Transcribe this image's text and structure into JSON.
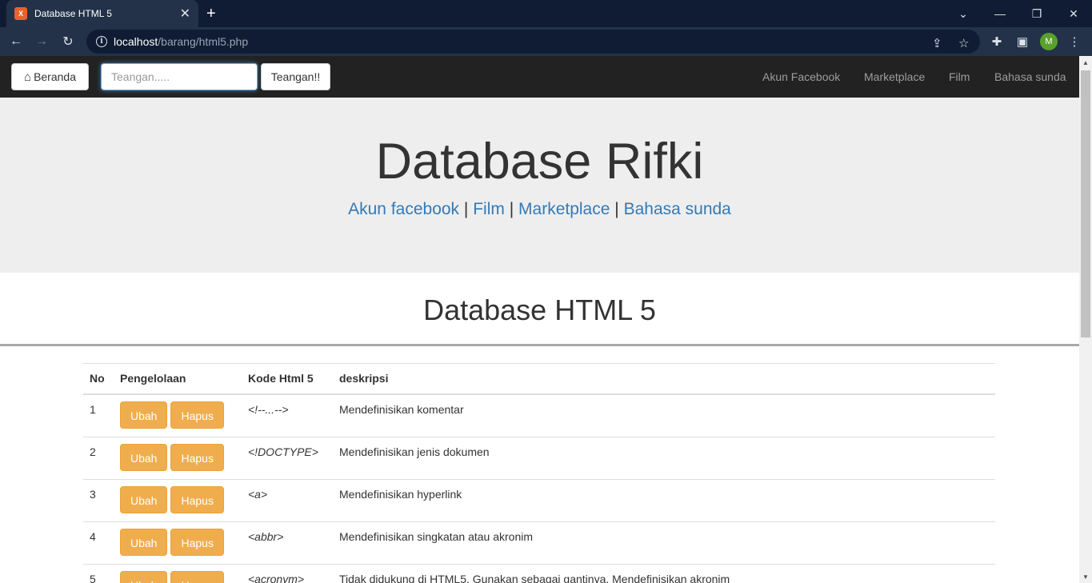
{
  "browser": {
    "tab_title": "Database HTML 5",
    "favicon_label": "X",
    "url_host": "localhost",
    "url_path": "/barang/html5.php",
    "profile_initial": "M",
    "icons": [
      "back-icon",
      "forward-icon",
      "reload-icon",
      "share-icon",
      "star-icon",
      "extensions-icon",
      "sidepanel-icon",
      "menu-icon",
      "minimize-icon",
      "restore-icon",
      "close-icon",
      "new-tab-icon",
      "tab-close-icon"
    ]
  },
  "navbar": {
    "home_label": "Beranda",
    "search_placeholder": "Teangan.....",
    "search_button": "Teangan!!",
    "links": [
      "Akun Facebook",
      "Marketplace",
      "Film",
      "Bahasa sunda"
    ]
  },
  "jumbotron": {
    "title": "Database Rifki",
    "links": [
      "Akun facebook",
      "Film",
      "Marketplace",
      "Bahasa sunda"
    ],
    "separator": "|"
  },
  "section": {
    "title": "Database HTML 5"
  },
  "table": {
    "headers": [
      "No",
      "Pengelolaan",
      "Kode Html 5",
      "deskripsi"
    ],
    "edit_label": "Ubah",
    "delete_label": "Hapus",
    "rows": [
      {
        "no": "1",
        "code": "<!--...-->",
        "desc": "Mendefinisikan komentar"
      },
      {
        "no": "2",
        "code": "<!DOCTYPE>",
        "desc": "Mendefinisikan jenis dokumen"
      },
      {
        "no": "3",
        "code": "<a>",
        "desc": "Mendefinisikan hyperlink"
      },
      {
        "no": "4",
        "code": "<abbr>",
        "desc": "Mendefinisikan singkatan atau akronim"
      },
      {
        "no": "5",
        "code": "<acronym>",
        "desc": "Tidak didukung di HTML5. Gunakan sebagai gantinya. Mendefinisikan akronim"
      }
    ]
  },
  "colors": {
    "chrome_dark": "#0f1c34",
    "chrome_toolbar": "#233249",
    "navbar_bg": "#222222",
    "jumbotron_bg": "#eeeeee",
    "link_blue": "#337ab7",
    "warning_btn": "#f0ad4e"
  }
}
